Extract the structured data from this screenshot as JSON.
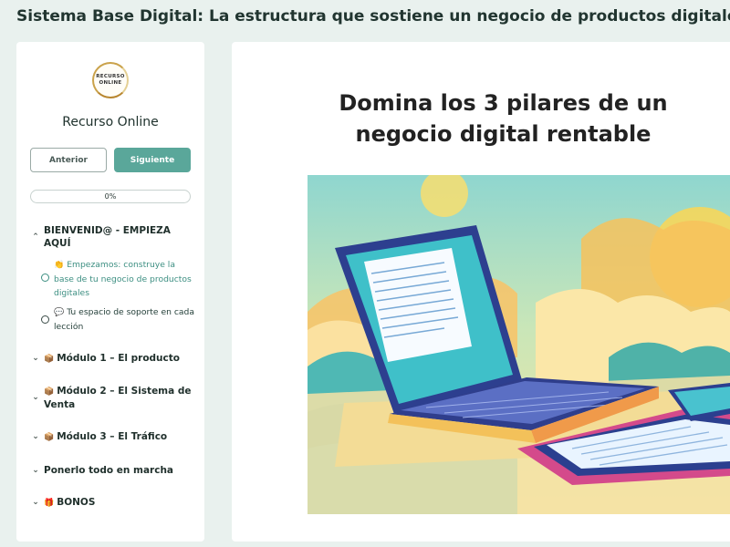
{
  "course": {
    "title": "Sistema Base Digital: La estructura que sostiene un negocio de productos digitales"
  },
  "sidebar": {
    "logo_text": [
      "RECURSO",
      "ONLINE"
    ],
    "brand": "Recurso Online",
    "prev_label": "Anterior",
    "next_label": "Siguiente",
    "progress": {
      "value": 0,
      "label": "0%"
    },
    "sections": [
      {
        "label": "BIENVENID@ - EMPIEZA AQUÍ",
        "expanded": true,
        "lessons": [
          {
            "icon": "👏",
            "label": "Empezamos: construye la base de tu negocio de productos digitales",
            "active": true
          },
          {
            "icon": "💬",
            "label": "Tu espacio de soporte en cada lección",
            "active": false
          }
        ]
      },
      {
        "icon": "📦",
        "label": "Módulo 1 – El producto",
        "expanded": false
      },
      {
        "icon": "📦",
        "label": "Módulo 2 – El Sistema de Venta",
        "expanded": false
      },
      {
        "icon": "📦",
        "label": "Módulo 3 – El Tráfico",
        "expanded": false
      },
      {
        "icon": "",
        "label": "Ponerlo todo en marcha",
        "expanded": false
      },
      {
        "icon": "🎁",
        "label": "BONOS",
        "expanded": false
      }
    ]
  },
  "main": {
    "lesson_title": "Domina los 3 pilares de un negocio digital rentable"
  },
  "colors": {
    "accent": "#5aa79a",
    "page_bg": "#e9f1ee"
  }
}
